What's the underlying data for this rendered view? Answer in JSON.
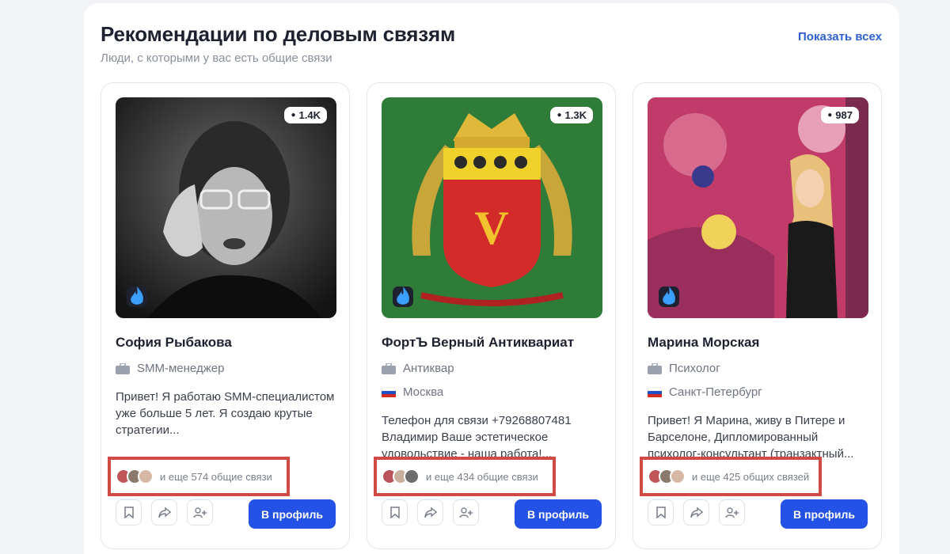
{
  "section": {
    "title": "Рекомендации по деловым связям",
    "subtitle": "Люди, с которыми у вас есть общие связи",
    "show_all": "Показать всех"
  },
  "cards": [
    {
      "followers": "1.4K",
      "name": "София Рыбакова",
      "role": "SMM-менеджер",
      "location": null,
      "bio": "Привет! Я работаю SMM-специалистом уже больше 5 лет. Я создаю крутые стратегии...",
      "mutual": "и еще 574 общие связи",
      "button": "В профиль"
    },
    {
      "followers": "1.3K",
      "name": "ФортЪ Верный Антиквариат",
      "role": "Антиквар",
      "location": "Москва",
      "bio": "Телефон для связи +79268807481 Владимир Ваше эстетическое удовольствие - наша работа!...",
      "mutual": "и еще 434 общие связи",
      "button": "В профиль"
    },
    {
      "followers": "987",
      "name": "Марина Морская",
      "role": "Психолог",
      "location": "Санкт-Петербург",
      "bio": "Привет! Я Марина, живу в Питере и Барселоне, Дипломированный психолог-консультант (транзактный...",
      "mutual": "и еще 425 общих связей",
      "button": "В профиль"
    }
  ],
  "icons": {
    "followers": "person-icon",
    "verified": "flame-icon",
    "role": "briefcase-icon",
    "location": "russia-flag-icon",
    "bookmark": "bookmark-icon",
    "share": "share-icon",
    "add_contact": "add-user-icon"
  },
  "colors": {
    "accent": "#2451e6",
    "link": "#2f5fd4",
    "highlight_box": "#d24a45"
  }
}
